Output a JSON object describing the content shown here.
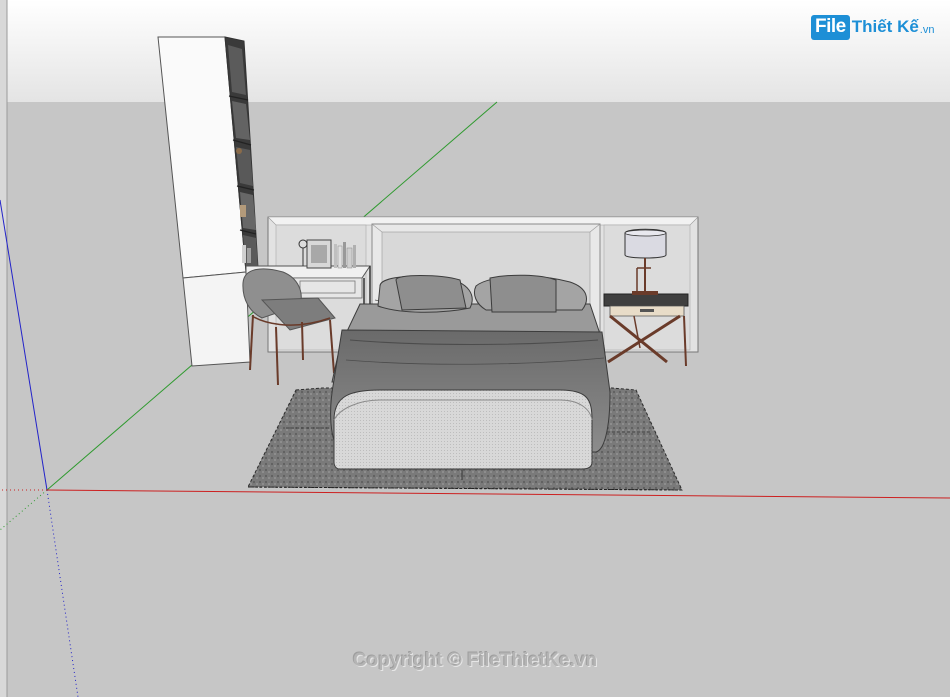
{
  "watermark": {
    "logo_file": "File",
    "logo_rest": "Thiết Kế",
    "logo_tld": ".vn",
    "copyright": "Copyright © FileThietKe.vn"
  },
  "colors": {
    "sky": "#ebebeb",
    "ground": "#c6c6c6",
    "axis_red": "#cc2020",
    "axis_green": "#2f9a2f",
    "axis_blue": "#2323c9",
    "brand_blue": "#1d8fd6"
  },
  "icons": {
    "logo": "file-thiet-ke-logo"
  }
}
